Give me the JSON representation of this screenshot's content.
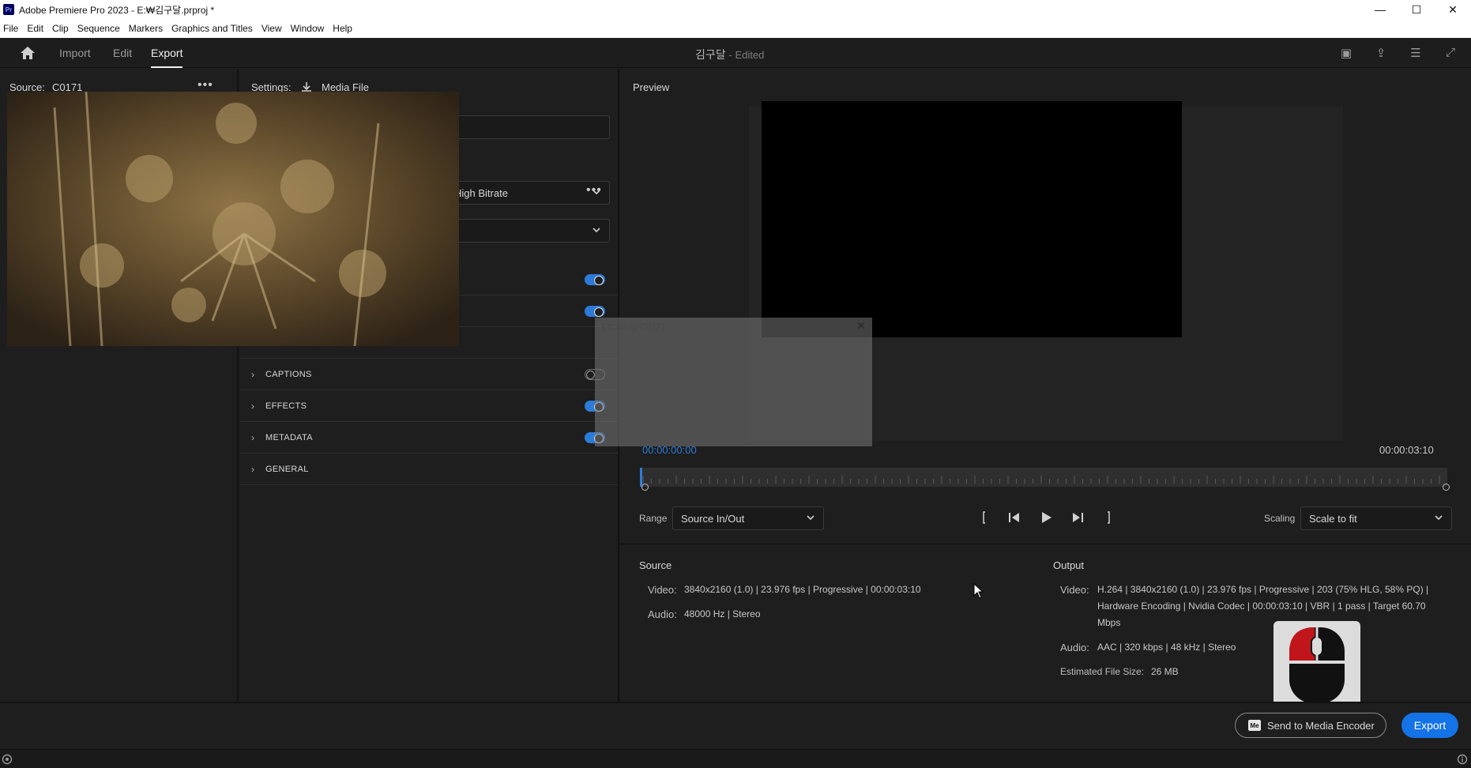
{
  "titlebar": {
    "app_icon": "Pr",
    "title": "Adobe Premiere Pro 2023 - E:₩김구달.prproj *",
    "controls": [
      "minimize-icon",
      "maximize-icon",
      "close-icon"
    ]
  },
  "menubar": {
    "items": [
      "File",
      "Edit",
      "Clip",
      "Sequence",
      "Markers",
      "Graphics and Titles",
      "View",
      "Window",
      "Help"
    ]
  },
  "workspace": {
    "home_icon": "home-icon",
    "tabs": [
      "Import",
      "Edit",
      "Export"
    ],
    "active_tab": "Export",
    "project_name": "김구달",
    "project_status": "- Edited",
    "right_icons": [
      "quick-export-icon",
      "share-icon",
      "workspaces-icon",
      "fullscreen-icon"
    ]
  },
  "source": {
    "label": "Source:",
    "clip": "C0171",
    "more": "•••"
  },
  "settings": {
    "label": "Settings:",
    "dest_icon": "download-icon",
    "dest": "Media File",
    "preset_value": "High Bitrate",
    "more": "•••",
    "sections": [
      {
        "label": "CAPTIONS",
        "enabled": false
      },
      {
        "label": "EFFECTS",
        "enabled": true
      },
      {
        "label": "METADATA",
        "enabled": true
      },
      {
        "label": "GENERAL",
        "enabled": null
      }
    ]
  },
  "encoding_dialog": {
    "title": "Encoding C0171",
    "close": "✕"
  },
  "preview": {
    "label": "Preview",
    "timecode_in": "00:00:00:00",
    "timecode_out": "00:00:03:10",
    "range_label": "Range",
    "range_value": "Source In/Out",
    "scaling_label": "Scaling",
    "scaling_value": "Scale to fit",
    "playhead_position": 0.0
  },
  "source_info": {
    "heading": "Source",
    "video_label": "Video:",
    "video_value": "3840x2160 (1.0) | 23.976 fps | Progressive | 00:00:03:10",
    "audio_label": "Audio:",
    "audio_value": "48000 Hz | Stereo"
  },
  "output_info": {
    "heading": "Output",
    "video_label": "Video:",
    "video_line1": "H.264 | 3840x2160 (1.0) | 23.976 fps | Progressive | 203 (75% HLG, 58% PQ) |",
    "video_line2": "Hardware Encoding | Nvidia Codec | 00:00:03:10 | VBR | 1 pass | Target 60.70",
    "video_line3": "Mbps",
    "audio_label": "Audio:",
    "audio_value": "AAC | 320 kbps | 48 kHz | Stereo",
    "size_label": "Estimated File Size:",
    "size_value": "26 MB"
  },
  "footer": {
    "send_icon": "Me",
    "send_label": "Send to Media Encoder",
    "export_label": "Export"
  },
  "colors": {
    "accent": "#1473e6",
    "toggle_on": "#2d7bd8",
    "timecode": "#2d7bd8"
  }
}
